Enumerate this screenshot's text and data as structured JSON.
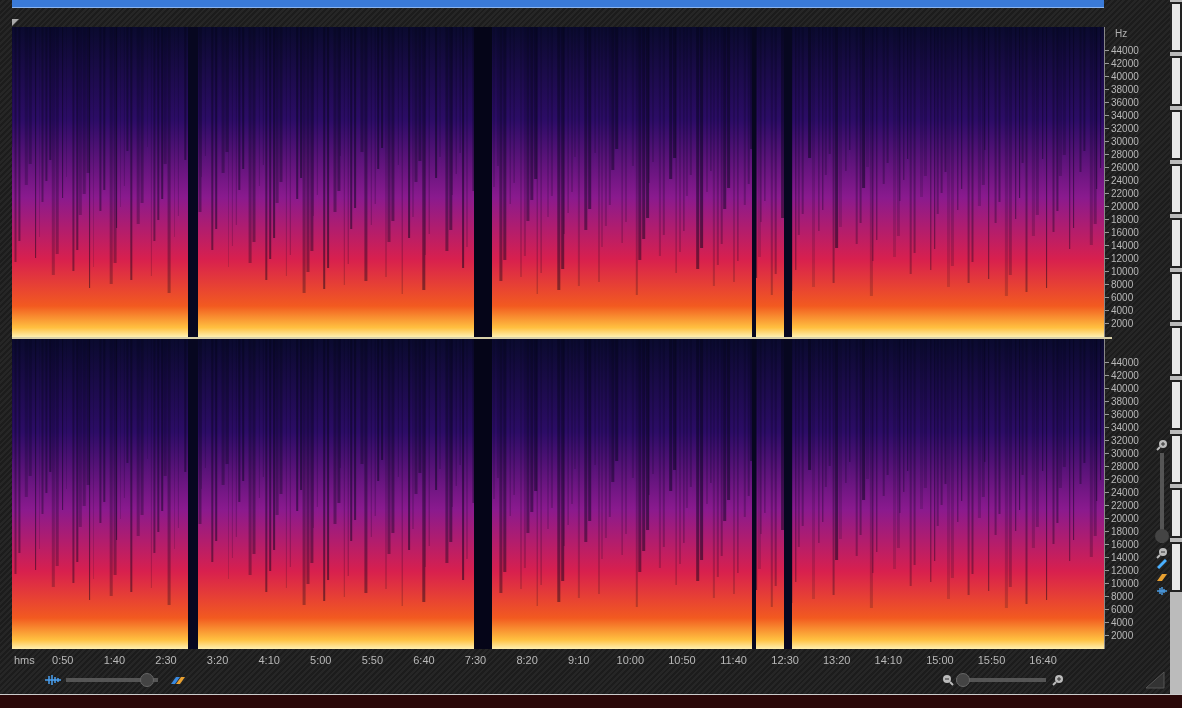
{
  "frequency_axes": [
    {
      "unit": "Hz",
      "ticks": [
        "44000",
        "42000",
        "40000",
        "38000",
        "36000",
        "34000",
        "32000",
        "30000",
        "28000",
        "26000",
        "24000",
        "22000",
        "20000",
        "18000",
        "16000",
        "14000",
        "12000",
        "10000",
        "8000",
        "6000",
        "4000",
        "2000"
      ]
    },
    {
      "ticks": [
        "44000",
        "42000",
        "40000",
        "38000",
        "36000",
        "34000",
        "32000",
        "30000",
        "28000",
        "26000",
        "24000",
        "22000",
        "20000",
        "18000",
        "16000",
        "14000",
        "12000",
        "10000",
        "8000",
        "6000",
        "4000",
        "2000"
      ]
    }
  ],
  "time_axis": {
    "unit": "hms",
    "ticks": [
      "0:50",
      "1:40",
      "2:30",
      "3:20",
      "4:10",
      "5:00",
      "5:50",
      "6:40",
      "7:30",
      "8:20",
      "9:10",
      "10:00",
      "10:50",
      "11:40",
      "12:30",
      "13:20",
      "14:10",
      "15:00",
      "15:50",
      "16:40"
    ]
  },
  "amplitude_zoom": {
    "level": 0.95
  },
  "time_zoom": {
    "level": 0
  },
  "frequency_zoom": {
    "level": 0
  }
}
